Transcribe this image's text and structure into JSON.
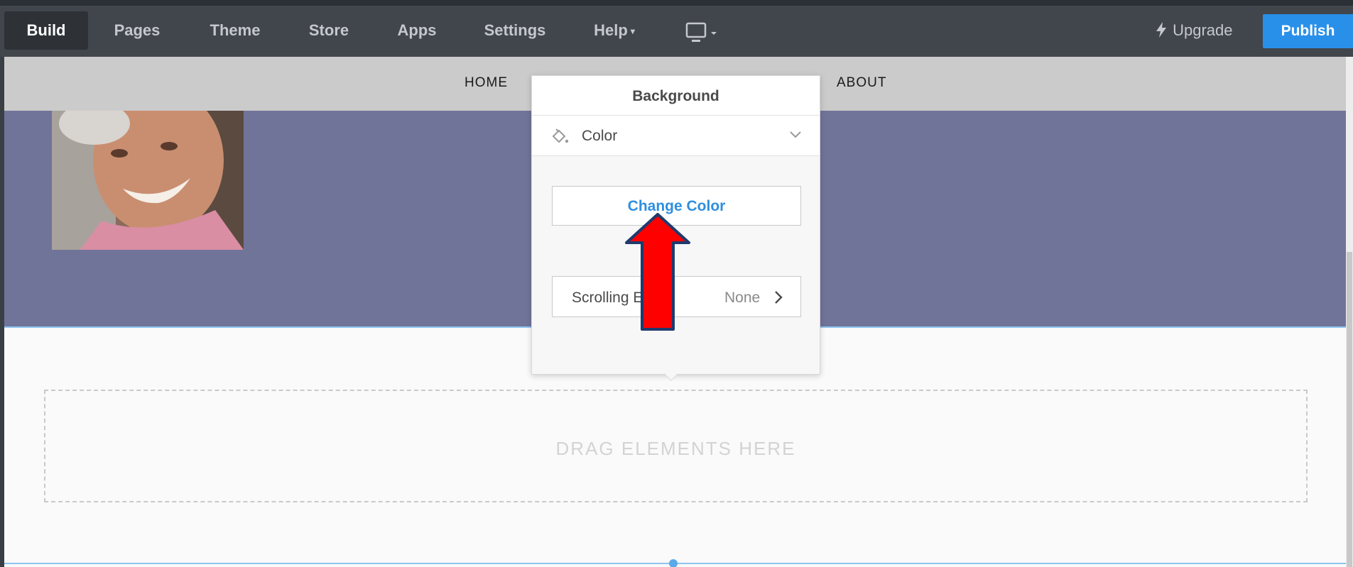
{
  "topbar": {
    "items": [
      {
        "label": "Build",
        "active": true
      },
      {
        "label": "Pages"
      },
      {
        "label": "Theme"
      },
      {
        "label": "Store"
      },
      {
        "label": "Apps"
      },
      {
        "label": "Settings"
      },
      {
        "label": "Help",
        "dropdown": true
      }
    ],
    "device_icon": "desktop-monitor-icon",
    "upgrade_label": "Upgrade",
    "upgrade_icon": "lightning-bolt-icon",
    "publish_label": "Publish"
  },
  "site_nav": {
    "links": [
      "HOME",
      "ABOUT"
    ]
  },
  "popover": {
    "title": "Background",
    "type_label": "Color",
    "type_icon": "paint-bucket-icon",
    "change_color_label": "Change Color",
    "scrolling_effect_label": "Scrolling Effect",
    "scrolling_effect_value": "None"
  },
  "dropzone_text": "DRAG ELEMENTS HERE",
  "colors": {
    "topbar": "#41464d",
    "accent": "#2990ea",
    "header_band": "#717499",
    "annotation_arrow": "#ff0000"
  }
}
